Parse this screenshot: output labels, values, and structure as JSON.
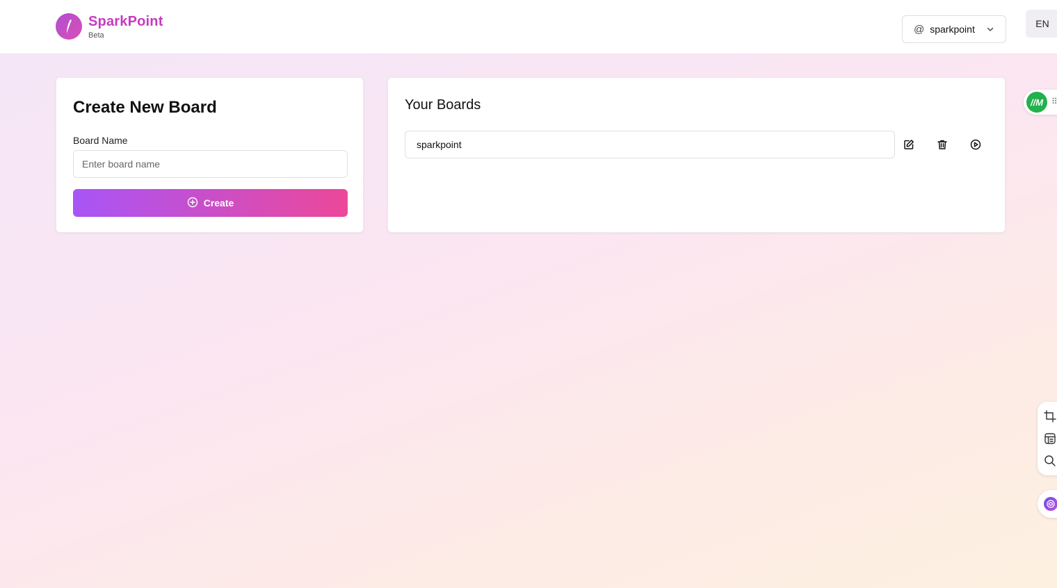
{
  "brand": {
    "name": "SparkPoint",
    "tag": "Beta"
  },
  "header": {
    "user": "sparkpoint",
    "language": "EN"
  },
  "create_card": {
    "title": "Create New Board",
    "label": "Board Name",
    "placeholder": "Enter board name",
    "button": "Create"
  },
  "boards_card": {
    "title": "Your Boards",
    "boards": [
      {
        "name": "sparkpoint"
      }
    ]
  },
  "widgets": {
    "badge": "//M"
  },
  "colors": {
    "brand": "#c53bbf",
    "gradient_start": "#a855f7",
    "gradient_end": "#ec4899"
  }
}
